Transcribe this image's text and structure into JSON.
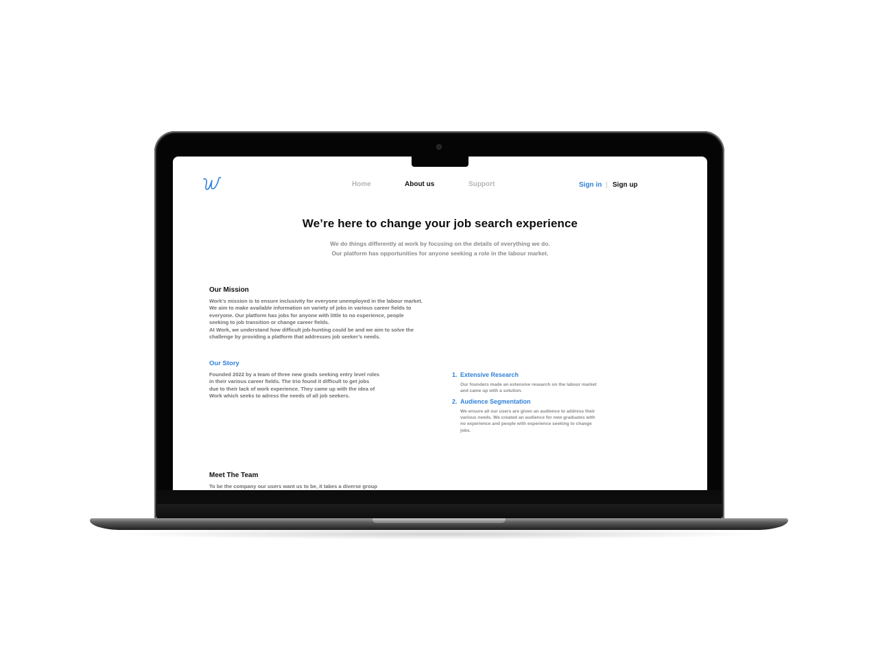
{
  "nav": {
    "logo_alt": "W",
    "links": [
      "Home",
      "About us",
      "Support"
    ],
    "active": "About us",
    "sign_in": "Sign in",
    "sign_up": "Sign up"
  },
  "hero": {
    "title": "We’re here to change your job search experience",
    "subtitle_lines": [
      "We do things differently at work by focusing on the details of everything we do.",
      "Our platform has opportunities for anyone seeking a role in the labour market."
    ]
  },
  "mission": {
    "title": "Our Mission",
    "lines": [
      "Work’s mission is to ensure inclusivity for everyone unemployed in the labour market.",
      "We aim to make available information on variety of jobs in various career fields to",
      "everyone. Our platform has jobs for anyone with little to no experience, people",
      "seeking to job transition or change career fields.",
      "At Work, we understand how difficult job-hunting could be and we aim to solve the",
      "challenge by providing a platform that addresses job seeker’s needs."
    ]
  },
  "story": {
    "title": "Our Story",
    "lines": [
      "Founded 2022 by a team of three new grads seeking entry level roles",
      "in their various career fields. The trio found it difficult to get jobs",
      "due to their lack of work experience. They came up with the idea of",
      "Work which seeks to adress the needs of all job seekers."
    ]
  },
  "features": [
    {
      "number": "1.",
      "title": "Extensive Research",
      "lines": [
        "Our founders made an extensive research on the labour market",
        "and came up with a solution."
      ]
    },
    {
      "number": "2.",
      "title": "Audience Segmentation",
      "lines": [
        "We ensure all our users are given an audience to address their",
        "various needs. We created an audience for new graduates with",
        "no experience and people with experience seeking to change",
        "jobs."
      ]
    }
  ],
  "team": {
    "title": "Meet The Team",
    "lines": [
      "To be the company our users want us to be, it takes a diverse group"
    ]
  },
  "colors": {
    "accent": "#2f80d9",
    "heading": "#111111",
    "muted": "#8a8a8a"
  }
}
